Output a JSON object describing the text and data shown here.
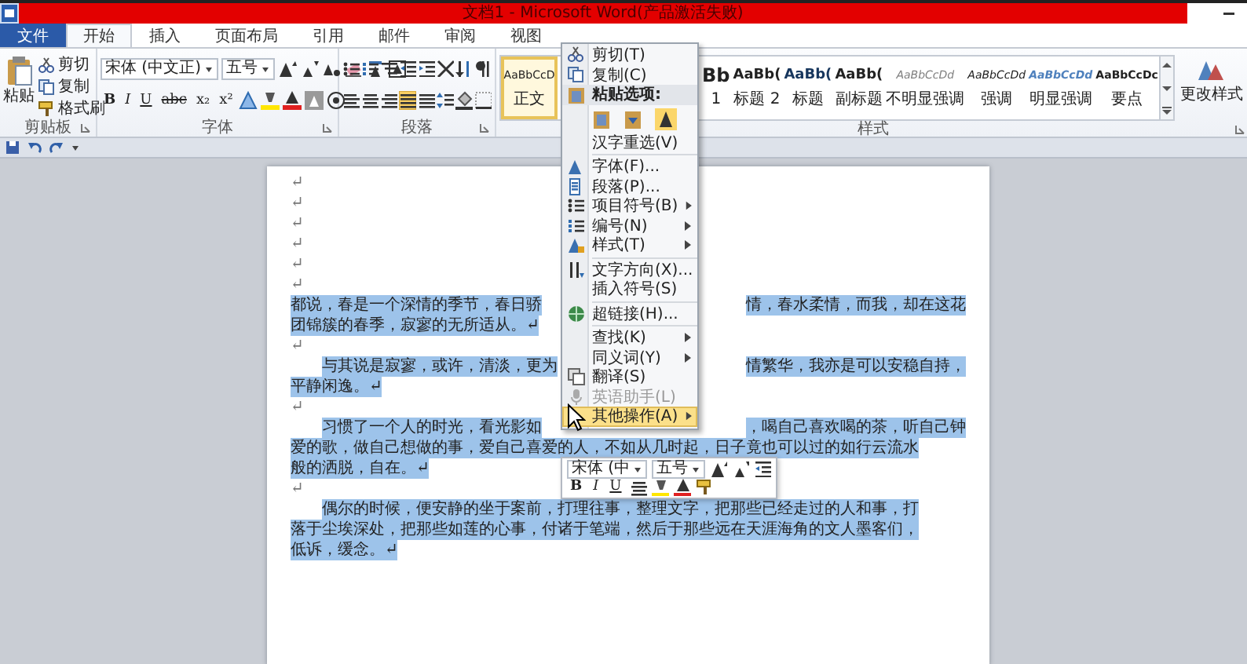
{
  "title_bar": {
    "title": "文档1 - Microsoft Word(产品激活失败)"
  },
  "tabs": [
    {
      "label": "文件",
      "kind": "file",
      "selected": false
    },
    {
      "label": "开始",
      "kind": "tab",
      "selected": true
    },
    {
      "label": "插入",
      "kind": "tab",
      "selected": false
    },
    {
      "label": "页面布局",
      "kind": "tab",
      "selected": false
    },
    {
      "label": "引用",
      "kind": "tab",
      "selected": false
    },
    {
      "label": "邮件",
      "kind": "tab",
      "selected": false
    },
    {
      "label": "审阅",
      "kind": "tab",
      "selected": false
    },
    {
      "label": "视图",
      "kind": "tab",
      "selected": false
    }
  ],
  "ribbon": {
    "clipboard": {
      "label": "剪贴板",
      "paste": "粘贴",
      "actions": [
        "剪切",
        "复制",
        "格式刷"
      ]
    },
    "font": {
      "label": "字体",
      "font_name": "宋体 (中文正)",
      "font_size": "五号",
      "format_buttons": [
        "B",
        "I",
        "U",
        "abc",
        "x₂",
        "x²"
      ]
    },
    "paragraph": {
      "label": "段落",
      "alignment_buttons": [
        {
          "selected": false
        },
        {
          "selected": false
        },
        {
          "selected": false
        },
        {
          "selected": true
        },
        {
          "selected": false
        }
      ]
    },
    "styles": {
      "label": "样式",
      "change_styles": "更改样式",
      "items": [
        {
          "sample": "AaBbCcD",
          "name": "正文",
          "kind": "normal",
          "selected": true
        },
        {
          "sample": "Bb",
          "name": "1",
          "kind": "cut",
          "selected": false
        },
        {
          "sample": "AaBb(",
          "name": "标题 2",
          "kind": "heading",
          "selected": false
        },
        {
          "sample": "AaBb(",
          "name": "标题",
          "kind": "title",
          "selected": false
        },
        {
          "sample": "AaBb(",
          "name": "副标题",
          "kind": "heading",
          "selected": false
        },
        {
          "sample": "AaBbCcDd",
          "name": "不明显强调",
          "kind": "subtle",
          "selected": false
        },
        {
          "sample": "AaBbCcDd",
          "name": "强调",
          "kind": "emphasis",
          "selected": false
        },
        {
          "sample": "AaBbCcDd",
          "name": "明显强调",
          "kind": "intense",
          "selected": false
        },
        {
          "sample": "AaBbCcDc",
          "name": "要点",
          "kind": "strong",
          "selected": false
        }
      ]
    }
  },
  "context_menu": {
    "items": [
      {
        "kind": "item",
        "label": "剪切(T)",
        "submenu": false,
        "disabled": false,
        "highlighted": false
      },
      {
        "kind": "item",
        "label": "复制(C)",
        "submenu": false,
        "disabled": false,
        "highlighted": false
      },
      {
        "kind": "header",
        "label": "粘贴选项:",
        "submenu": false,
        "disabled": false,
        "highlighted": false
      },
      {
        "kind": "paste-row"
      },
      {
        "kind": "item",
        "label": "汉字重选(V)",
        "submenu": false,
        "disabled": false,
        "highlighted": false
      },
      {
        "kind": "separator"
      },
      {
        "kind": "item",
        "label": "字体(F)...",
        "submenu": false,
        "disabled": false,
        "highlighted": false
      },
      {
        "kind": "item",
        "label": "段落(P)...",
        "submenu": false,
        "disabled": false,
        "highlighted": false
      },
      {
        "kind": "item",
        "label": "项目符号(B)",
        "submenu": true,
        "disabled": false,
        "highlighted": false
      },
      {
        "kind": "item",
        "label": "编号(N)",
        "submenu": true,
        "disabled": false,
        "highlighted": false
      },
      {
        "kind": "item",
        "label": "样式(T)",
        "submenu": true,
        "disabled": false,
        "highlighted": false
      },
      {
        "kind": "separator"
      },
      {
        "kind": "item",
        "label": "文字方向(X)...",
        "submenu": false,
        "disabled": false,
        "highlighted": false
      },
      {
        "kind": "item",
        "label": "插入符号(S)",
        "submenu": false,
        "disabled": false,
        "highlighted": false
      },
      {
        "kind": "separator"
      },
      {
        "kind": "item",
        "label": "超链接(H)...",
        "submenu": false,
        "disabled": false,
        "highlighted": false
      },
      {
        "kind": "separator"
      },
      {
        "kind": "item",
        "label": "查找(K)",
        "submenu": true,
        "disabled": false,
        "highlighted": false
      },
      {
        "kind": "item",
        "label": "同义词(Y)",
        "submenu": true,
        "disabled": false,
        "highlighted": false
      },
      {
        "kind": "item",
        "label": "翻译(S)",
        "submenu": false,
        "disabled": false,
        "highlighted": false
      },
      {
        "kind": "item",
        "label": "英语助手(L)",
        "submenu": false,
        "disabled": true,
        "highlighted": false
      },
      {
        "kind": "item",
        "label": "其他操作(A)",
        "submenu": true,
        "disabled": false,
        "highlighted": true
      }
    ]
  },
  "mini_toolbar": {
    "font_name": "宋体 (中",
    "font_size": "五号",
    "format_buttons": [
      "B",
      "I",
      "U"
    ]
  },
  "document": {
    "lines": [
      {
        "kind": "mark",
        "text": "↵",
        "selected": false
      },
      {
        "kind": "mark",
        "text": "↵",
        "selected": false
      },
      {
        "kind": "mark",
        "text": "↵",
        "selected": false
      },
      {
        "kind": "mark",
        "text": "↵",
        "selected": false
      },
      {
        "kind": "mark",
        "text": "↵",
        "selected": false
      },
      {
        "kind": "mark",
        "text": "↵",
        "selected": false
      },
      {
        "kind": "split",
        "left": "都说，春是一个深情的季节，春日骄",
        "right": "情，春水柔情，而我，却在这花",
        "indent": false,
        "selected": true
      },
      {
        "kind": "end",
        "text": "团锦簇的春季，寂寥的无所适从。↵",
        "indent": false,
        "selected": true
      },
      {
        "kind": "mark",
        "text": "↵",
        "selected": false
      },
      {
        "kind": "split",
        "left": "与其说是寂寥，或许，清淡，更为",
        "right": "情繁华，我亦是可以安稳自持，",
        "indent": true,
        "selected": true
      },
      {
        "kind": "end",
        "text": "平静闲逸。↵",
        "indent": false,
        "selected": true
      },
      {
        "kind": "mark",
        "text": "↵",
        "selected": false
      },
      {
        "kind": "split",
        "left": "习惯了一个人的时光，看光影如",
        "right": "，喝自己喜欢喝的茶，听自己钟",
        "indent": true,
        "selected": true
      },
      {
        "kind": "full",
        "text": "爱的歌，做自己想做的事，爱自己喜爱的人，不如从几时起，日子竟也可以过的如行云流水",
        "indent": false,
        "selected": true
      },
      {
        "kind": "end",
        "text": "般的洒脱，自在。↵",
        "indent": false,
        "selected": true
      },
      {
        "kind": "mark",
        "text": "↵",
        "selected": false
      },
      {
        "kind": "full",
        "text": "偶尔的时候，便安静的坐于案前，打理往事，整理文字，把那些已经走过的人和事，打",
        "indent": true,
        "selected": true
      },
      {
        "kind": "full",
        "text": "落于尘埃深处，把那些如莲的心事，付诸于笔端，然后于那些远在天涯海角的文人墨客们，",
        "indent": false,
        "selected": true
      },
      {
        "kind": "end",
        "text": "低诉，缓念。↵",
        "indent": false,
        "selected": true
      }
    ]
  }
}
